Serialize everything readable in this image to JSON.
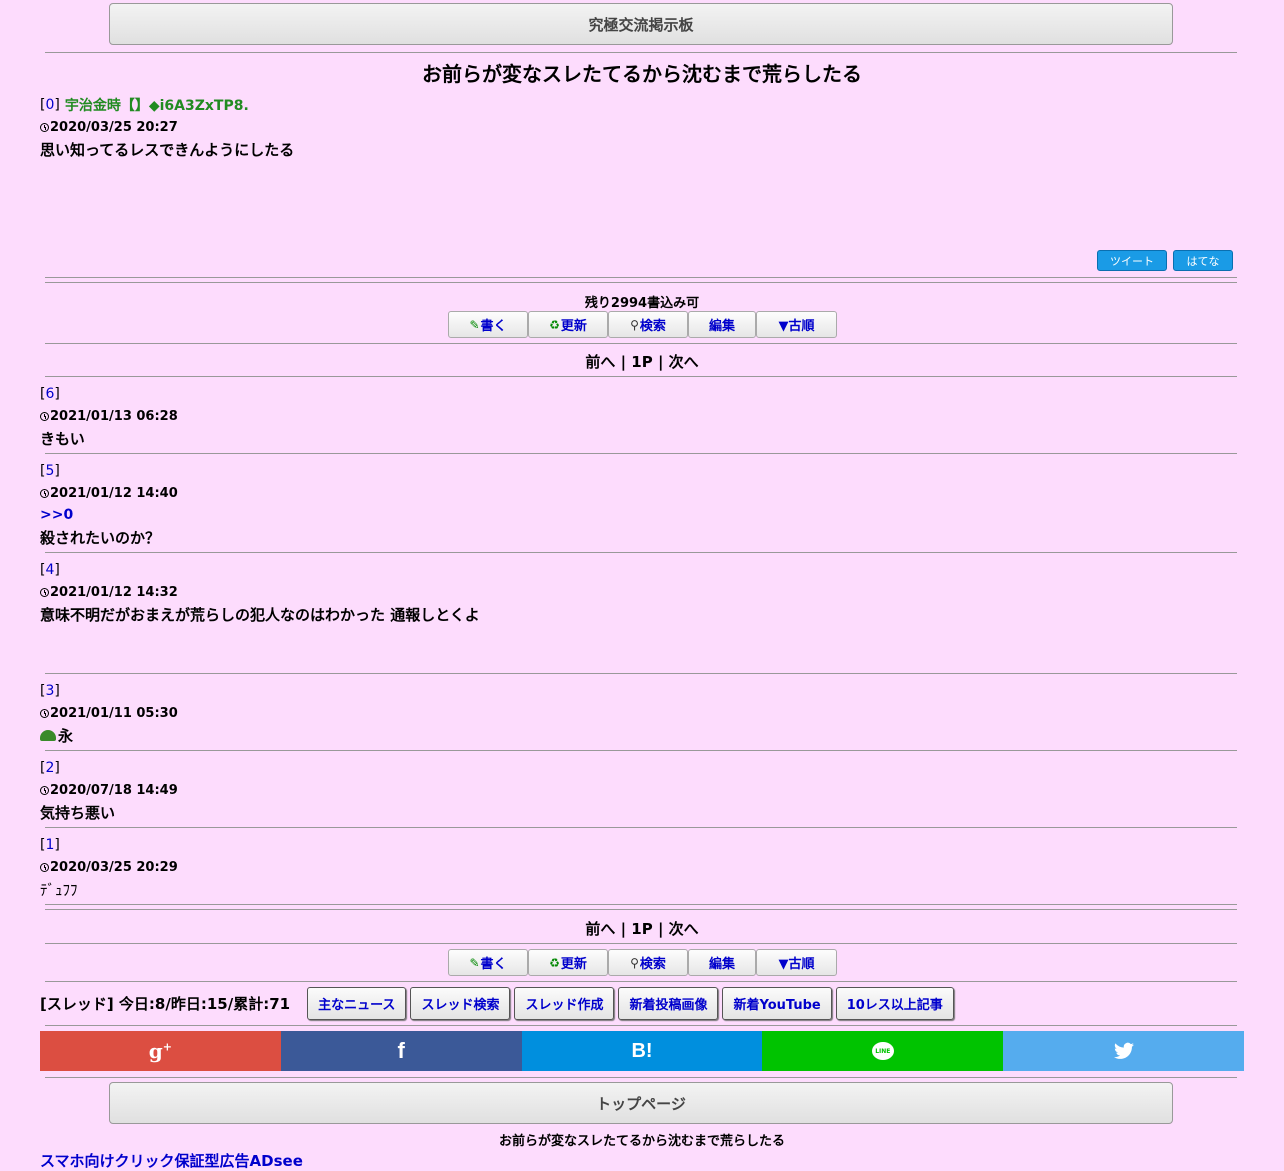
{
  "header": {
    "board_title": "究極交流掲示板"
  },
  "thread": {
    "title": "お前らが変なスレたてるから沈むまで荒らしたる",
    "op": {
      "num": "0",
      "name": "宇治金時【】◆i6A3ZxTP8.",
      "date": "2020/03/25 20:27",
      "body": "思い知ってるレスできんようにしたる"
    }
  },
  "share_small": {
    "tweet": "ツイート",
    "hatena": "はてな"
  },
  "remaining": "残り2994書込み可",
  "toolbar": {
    "write": "書く",
    "refresh": "更新",
    "search": "検索",
    "edit": "編集",
    "order": "▼古順"
  },
  "pager": {
    "prev": "前へ",
    "sep1": "|",
    "page": "1P",
    "sep2": "|",
    "next": "次へ"
  },
  "posts": [
    {
      "num": "6",
      "date": "2021/01/13 06:28",
      "body": "きもい"
    },
    {
      "num": "5",
      "date": "2021/01/12 14:40",
      "anchor": ">>0",
      "body": "殺されたいのか？"
    },
    {
      "num": "4",
      "date": "2021/01/12 14:32",
      "body": "意味不明だがおまえが荒らしの犯人なのはわかった 通報しとくよ"
    },
    {
      "num": "3",
      "date": "2021/01/11 05:30",
      "body": "永"
    },
    {
      "num": "2",
      "date": "2020/07/18 14:49",
      "body": "気持ち悪い"
    },
    {
      "num": "1",
      "date": "2020/03/25 20:29",
      "body": "ﾃﾞｭﾌﾌ"
    }
  ],
  "footer": {
    "stats": "[スレッド] 今日:8/昨日:15/累計:71",
    "nav": [
      "主なニュース",
      "スレッド検索",
      "スレッド作成",
      "新着投稿画像",
      "新着YouTube",
      "10レス以上記事"
    ],
    "share": [
      {
        "label": "g+",
        "color": "#dc4e41",
        "icon": "google-plus-icon"
      },
      {
        "label": "f",
        "color": "#3b5998",
        "icon": "facebook-icon"
      },
      {
        "label": "B!",
        "color": "#008fde",
        "icon": "hatena-icon"
      },
      {
        "label": "LINE",
        "color": "#00c300",
        "icon": "line-icon"
      },
      {
        "label": "twitter",
        "color": "#55acee",
        "icon": "twitter-icon"
      }
    ],
    "top_page": "トップページ",
    "bottom_title": "お前らが変なスレたてるから沈むまで荒らしたる",
    "ad_link": "スマホ向けクリック保証型広告ADsee"
  }
}
